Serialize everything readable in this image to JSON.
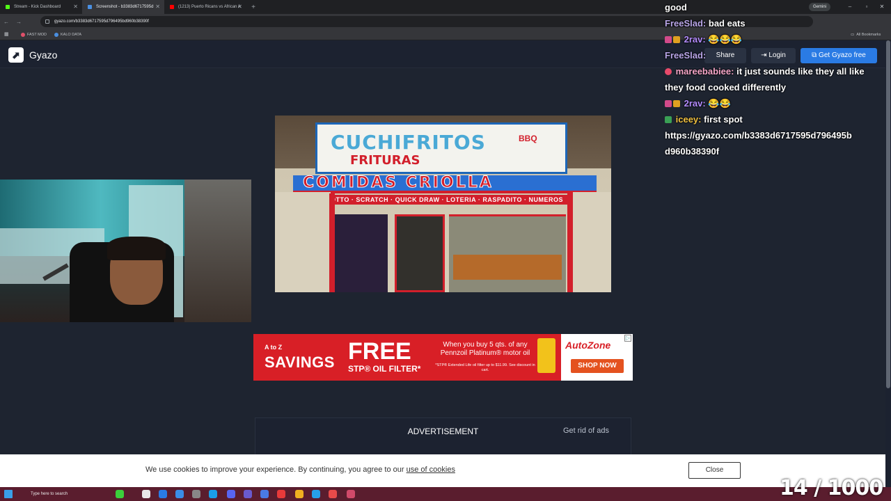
{
  "browser": {
    "tabs": [
      {
        "title": "Stream - Kick Dashboard",
        "active": false,
        "color": "#53fc18"
      },
      {
        "title": "Screenshot - b3383d6717595d",
        "active": true,
        "color": "#4a90e2"
      },
      {
        "title": "(1213) Puerto Ricans vs African A",
        "active": false,
        "color": "#ff0000"
      }
    ],
    "new_tab": "+",
    "gemini": "Gemini",
    "url": "gyazo.com/b3383d6717595d796495bd960b38390f",
    "bookmarks": [
      {
        "label": "FAST MOD",
        "color": "#e0506a"
      },
      {
        "label": "KALO DATA",
        "color": "#4a8fe0"
      }
    ],
    "all_bookmarks": "All Bookmarks"
  },
  "gyazo": {
    "logo": "Gyazo",
    "share": "Share",
    "login": "Login",
    "get_free": "Get Gyazo free"
  },
  "screenshot": {
    "sign_top": "CUCHIFRITOS",
    "sign_top2": "FRITURAS",
    "sign_bbq": "BBQ",
    "sign_main": "COMIDAS CRIOLLA",
    "sign_strip": "LOTTO · SCRATCH · QUICK DRAW · LOTERIA · RASPADITO · NUMEROS"
  },
  "chat": [
    {
      "user": "",
      "text": "good",
      "color": "#ffffff"
    },
    {
      "user": "FreeSlad:",
      "text": "bad eats",
      "color": "#b9a6e8"
    },
    {
      "user": "2rav:",
      "text": "😂😂😂",
      "color": "#b48cff"
    },
    {
      "user": "FreeSlad:",
      "text": "",
      "color": "#b9a6e8"
    },
    {
      "user": "mareebabiee:",
      "text": "it just sounds like they all like",
      "color": "#f5a6c8"
    },
    {
      "user": "",
      "text": "they food cooked differently",
      "color": "#ffffff"
    },
    {
      "user": "2rav:",
      "text": "😂😂",
      "color": "#b48cff"
    },
    {
      "user": "iceey:",
      "text": "first spot",
      "color": "#f0c040"
    },
    {
      "user": "",
      "text": "https://gyazo.com/b3383d6717595d796495b",
      "color": "#ffffff"
    },
    {
      "user": "",
      "text": "d960b38390f",
      "color": "#ffffff"
    }
  ],
  "ad": {
    "a_to_z": "A to Z",
    "savings": "SAVINGS",
    "free": "FREE",
    "stp": "STP® OIL FILTER*",
    "offer": "When you buy 5 qts. of any Pennzoil Platinum® motor oil",
    "fine": "*STP® Extended Life oil filter up to $11.99. See discount in cart.",
    "brand": "AutoZone",
    "cta": "SHOP NOW"
  },
  "ad_box": {
    "label": "ADVERTISEMENT",
    "remove": "Get rid of ads"
  },
  "cookie": {
    "message": "We use cookies to improve your experience. By continuing, you agree to our ",
    "link": "use of cookies",
    "close": "Close"
  },
  "taskbar": {
    "search": "Type here to search"
  },
  "overlay": {
    "counter": "14 / 1000"
  }
}
